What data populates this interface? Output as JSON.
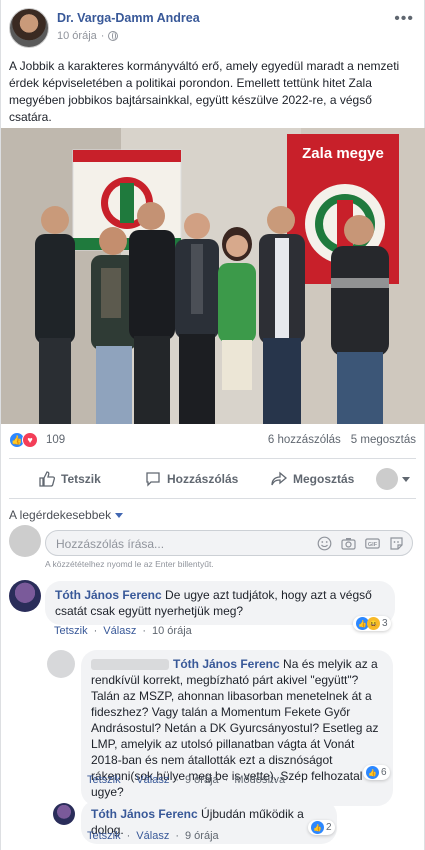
{
  "post": {
    "author": "Dr. Varga-Damm Andrea",
    "time": "10 órája",
    "text": "A Jobbik a karakteres kormányváltó erő, amely egyedül maradt a nemzeti érdek képviseletében a politikai porondon. Emellett tettünk hitet Zala megyében jobbikos bajtársainkkal, együtt készülve 2022-re, a végső csatára.",
    "photo": {
      "banner_text": "Zala megye",
      "colors": {
        "red": "#c8202a",
        "green": "#1f7a3d",
        "white": "#f4f1ea"
      }
    }
  },
  "stats": {
    "reaction_count": "109",
    "comments": "6 hozzászólás",
    "shares": "5 megosztás"
  },
  "actions": {
    "like": "Tetszik",
    "comment": "Hozzászólás",
    "share": "Megosztás"
  },
  "filter_label": "A legérdekesebbek",
  "composer": {
    "placeholder": "Hozzászólás írása...",
    "hint": "A közzétételhez nyomd le az Enter billentyűt."
  },
  "comments": [
    {
      "name": "Tóth János Ferenc",
      "text": "De ugye azt tudjátok, hogy azt a végső csatát csak együtt nyerhetjük meg?",
      "like": "Tetszik",
      "reply": "Válasz",
      "time": "10 órája",
      "reactions": "3"
    },
    {
      "name": "Tóth János Ferenc",
      "text": "Na és melyik az a rendkívül korrekt, megbízható párt akivel \"együtt\"? Talán az MSZP, ahonnan libasorban menetelnek át a fideszhez? Vagy talán a Momentum Fekete Győr Andrásostul? Netán a DK Gyurcsányostul? Esetleg az LMP, amelyik az utolsó pillanatban vágta át Vonát 2018-ban és nem átallották ezt a disznóságot rákenni(sok hülye meg be is vette). Szép felhozatal ugye?",
      "like": "Tetszik",
      "reply": "Válasz",
      "time": "9 órája",
      "edited": "Módosítva",
      "reactions": "6"
    },
    {
      "name": "Tóth János Ferenc",
      "text": "Újbudán működik a dolog.",
      "like": "Tetszik",
      "reply": "Válasz",
      "time": "9 órája",
      "reactions": "2"
    }
  ]
}
